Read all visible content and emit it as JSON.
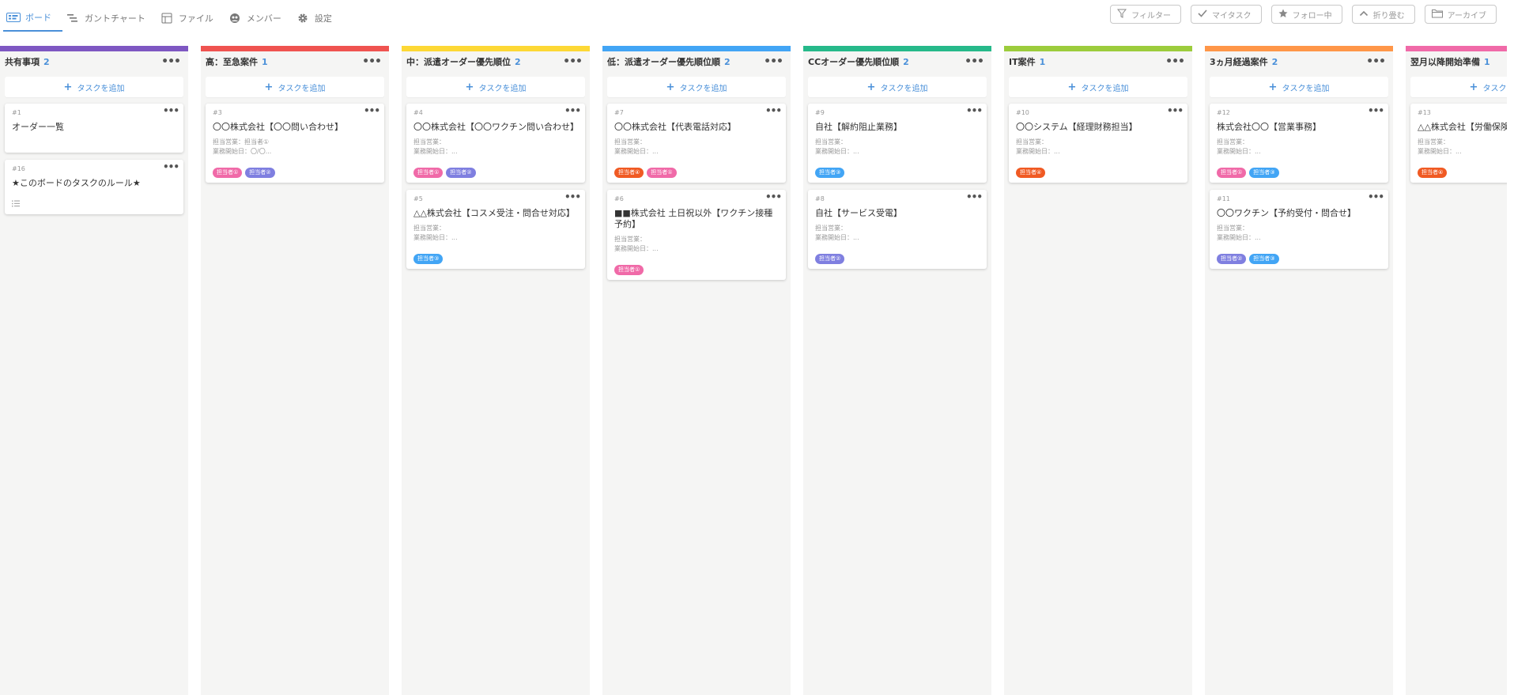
{
  "nav": {
    "tabs": [
      {
        "label": "ボード",
        "icon": "board-icon",
        "active": true
      },
      {
        "label": "ガントチャート",
        "icon": "gantt-icon"
      },
      {
        "label": "ファイル",
        "icon": "file-icon"
      },
      {
        "label": "メンバー",
        "icon": "members-icon"
      },
      {
        "label": "設定",
        "icon": "gear-icon"
      }
    ]
  },
  "actions": [
    {
      "label": "フィルター",
      "icon": "filter-icon"
    },
    {
      "label": "マイタスク",
      "icon": "check-icon"
    },
    {
      "label": "フォロー中",
      "icon": "star-icon"
    },
    {
      "label": "折り畳む",
      "icon": "collapse-icon"
    },
    {
      "label": "アーカイブ",
      "icon": "folder-icon"
    }
  ],
  "add_task_label": "タスクを追加",
  "colors": {
    "pink": "#f06aa8",
    "purple": "#7f7fe0",
    "blue": "#42a5f5",
    "orange": "#f05a23",
    "accent": "#4a90d9"
  },
  "columns": [
    {
      "title": "共有事項",
      "count": "2",
      "color": "#7e57c2",
      "cards": [
        {
          "id": "#1",
          "title": "オーダー一覧",
          "lines": [],
          "tags": [],
          "min_height": 62
        },
        {
          "id": "#16",
          "title": "★このボードのタスクのルール★",
          "lines": [],
          "tags": [],
          "list_icon": true
        }
      ]
    },
    {
      "title": "高：至急案件",
      "count": "1",
      "color": "#ef5350",
      "cards": [
        {
          "id": "#3",
          "title": "〇〇株式会社【〇〇問い合わせ】",
          "lines": [
            "担当営業：担当者①",
            "業務開始日：〇/〇..."
          ],
          "tags": [
            {
              "label": "担当者①",
              "color": "pink"
            },
            {
              "label": "担当者②",
              "color": "purple"
            }
          ]
        }
      ]
    },
    {
      "title": "中：派遣オーダー優先順位",
      "count": "2",
      "color": "#fdd835",
      "cards": [
        {
          "id": "#4",
          "title": "〇〇株式会社【〇〇ワクチン問い合わせ】",
          "lines": [
            "担当営業：",
            "業務開始日：..."
          ],
          "tags": [
            {
              "label": "担当者①",
              "color": "pink"
            },
            {
              "label": "担当者②",
              "color": "purple"
            }
          ]
        },
        {
          "id": "#5",
          "title": "△△株式会社【コスメ受注・問合せ対応】",
          "lines": [
            "担当営業：",
            "業務開始日：..."
          ],
          "tags": [
            {
              "label": "担当者③",
              "color": "blue"
            }
          ]
        }
      ]
    },
    {
      "title": "低：派遣オーダー優先順位順",
      "count": "2",
      "color": "#42a5f5",
      "cards": [
        {
          "id": "#7",
          "title": "〇〇株式会社【代表電話対応】",
          "lines": [
            "担当営業：",
            "業務開始日：..."
          ],
          "tags": [
            {
              "label": "担当者④",
              "color": "orange"
            },
            {
              "label": "担当者①",
              "color": "pink"
            }
          ]
        },
        {
          "id": "#6",
          "title": "■■株式会社 土日祝以外【ワクチン接種予約】",
          "lines": [
            "担当営業：",
            "業務開始日：..."
          ],
          "tags": [
            {
              "label": "担当者①",
              "color": "pink"
            }
          ]
        }
      ]
    },
    {
      "title": "CCオーダー優先順位順",
      "count": "2",
      "color": "#26b98a",
      "cards": [
        {
          "id": "#9",
          "title": "自社【解約阻止業務】",
          "lines": [
            "担当営業：",
            "業務開始日：..."
          ],
          "tags": [
            {
              "label": "担当者③",
              "color": "blue"
            }
          ]
        },
        {
          "id": "#8",
          "title": "自社【サービス受電】",
          "lines": [
            "担当営業：",
            "業務開始日：..."
          ],
          "tags": [
            {
              "label": "担当者②",
              "color": "purple"
            }
          ]
        }
      ]
    },
    {
      "title": "IT案件",
      "count": "1",
      "color": "#9ccc3c",
      "cards": [
        {
          "id": "#10",
          "title": "〇〇システム【経理財務担当】",
          "lines": [
            "担当営業：",
            "業務開始日：..."
          ],
          "tags": [
            {
              "label": "担当者④",
              "color": "orange"
            }
          ]
        }
      ]
    },
    {
      "title": "3ヵ月経過案件",
      "count": "2",
      "color": "#ff9648",
      "cards": [
        {
          "id": "#12",
          "title": "株式会社〇〇【営業事務】",
          "lines": [
            "担当営業：",
            "業務開始日：..."
          ],
          "tags": [
            {
              "label": "担当者①",
              "color": "pink"
            },
            {
              "label": "担当者③",
              "color": "blue"
            }
          ]
        },
        {
          "id": "#11",
          "title": "〇〇ワクチン【予約受付・問合せ】",
          "lines": [
            "担当営業：",
            "業務開始日：..."
          ],
          "tags": [
            {
              "label": "担当者②",
              "color": "purple"
            },
            {
              "label": "担当者③",
              "color": "blue"
            }
          ]
        }
      ]
    },
    {
      "title": "翌月以降開始準備",
      "count": "1",
      "color": "#f06aa8",
      "cards": [
        {
          "id": "#13",
          "title": "△△株式会社【労働保険担当者】",
          "lines": [
            "担当営業：",
            "業務開始日：..."
          ],
          "tags": [
            {
              "label": "担当者④",
              "color": "orange"
            }
          ]
        }
      ]
    }
  ]
}
